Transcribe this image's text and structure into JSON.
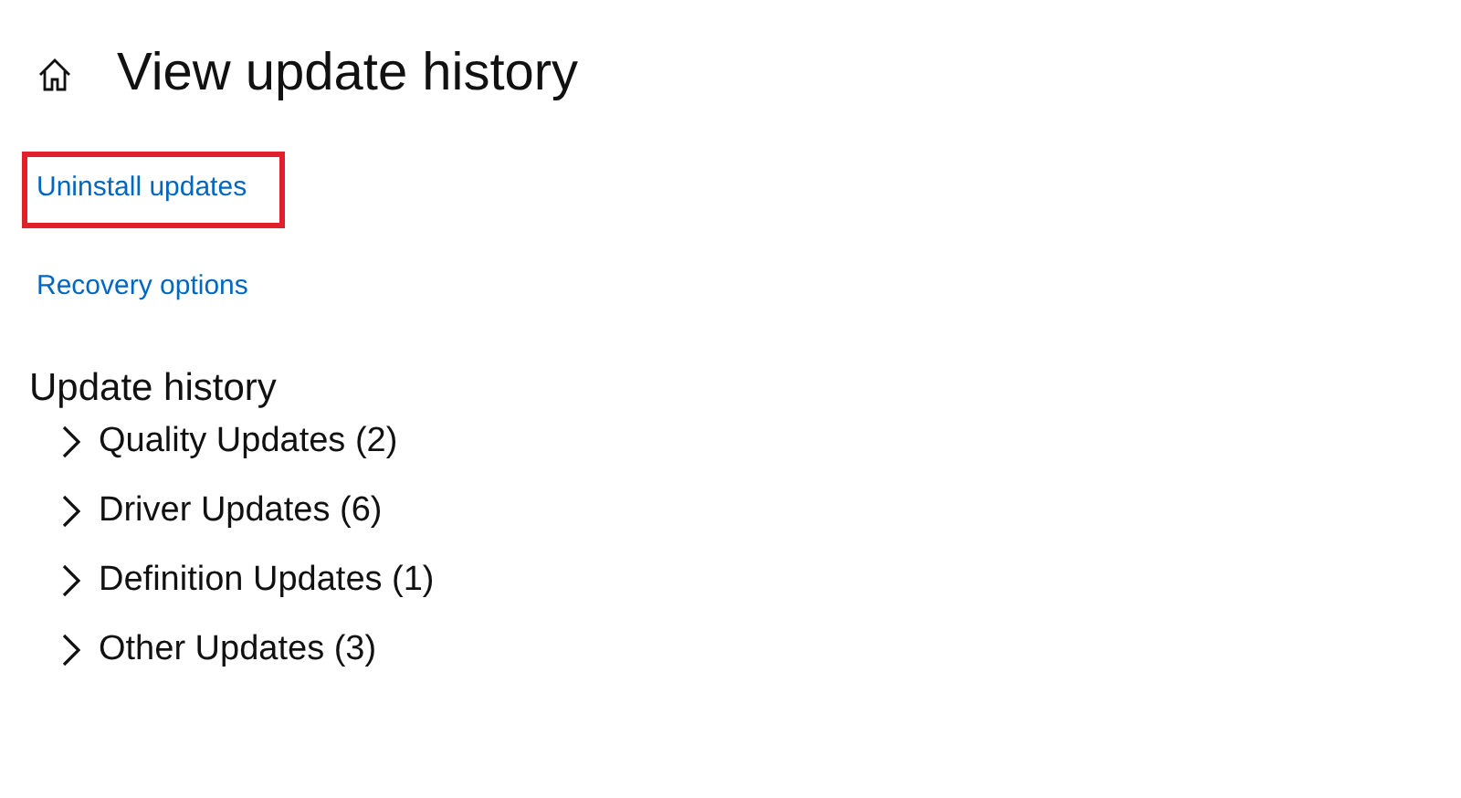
{
  "page": {
    "title": "View update history"
  },
  "links": [
    {
      "label": "Uninstall updates",
      "highlighted": true
    },
    {
      "label": "Recovery options",
      "highlighted": false
    }
  ],
  "update_history": {
    "heading": "Update history",
    "groups": [
      {
        "label": "Quality Updates (2)",
        "expanded": false
      },
      {
        "label": "Driver Updates (6)",
        "expanded": false
      },
      {
        "label": "Definition Updates (1)",
        "expanded": false
      },
      {
        "label": "Other Updates (3)",
        "expanded": false
      }
    ]
  }
}
